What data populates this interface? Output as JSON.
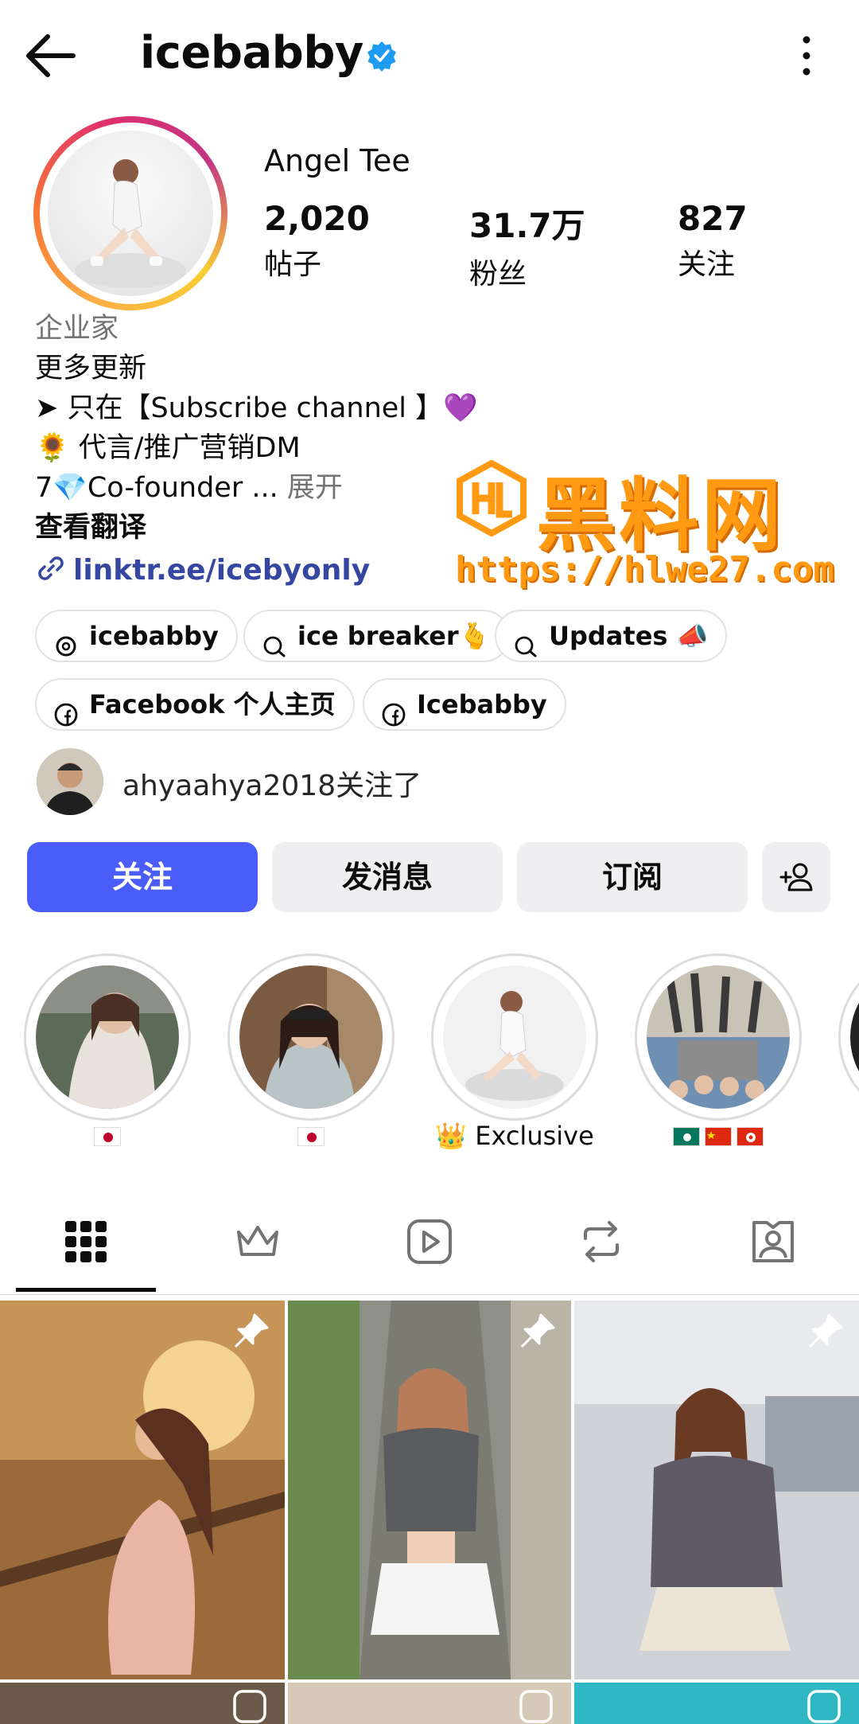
{
  "header": {
    "username": "icebabby",
    "verified": true
  },
  "profile": {
    "display_name": "Angel Tee",
    "stats": [
      {
        "value": "2,020",
        "label": "帖子"
      },
      {
        "value": "31.7万",
        "label": "粉丝"
      },
      {
        "value": "827",
        "label": "关注"
      }
    ],
    "bio": {
      "category": "企业家",
      "lines": [
        "更多更新",
        "➤ 只在【Subscribe channel 】💜",
        "🌻 代言/推广营销DM"
      ],
      "truncated_line": "7💎Co-founder ...",
      "more_label": "展开",
      "translate_label": "查看翻译"
    },
    "link": "linktr.ee/icebyonly"
  },
  "chips": [
    {
      "label": "icebabby",
      "icon": "threads-icon"
    },
    {
      "label": "ice breaker🫰",
      "icon": "channel-icon"
    },
    {
      "label": "Updates 📣",
      "icon": "channel-icon"
    },
    {
      "label": "Facebook 个人主页",
      "icon": "facebook-icon"
    },
    {
      "label": "Icebabby",
      "icon": "facebook-icon"
    }
  ],
  "followed_by": "ahyaahya2018关注了",
  "actions": {
    "follow": "关注",
    "message": "发消息",
    "subscribe": "订阅"
  },
  "highlights": [
    {
      "label": "🇯🇵"
    },
    {
      "label": "🇯🇵"
    },
    {
      "label": "👑 Exclusive"
    },
    {
      "label": "🇲🇴🇨🇳🇭🇰"
    }
  ],
  "tabs": [
    "grid-icon",
    "crown-icon",
    "reels-icon",
    "repost-icon",
    "tagged-icon"
  ],
  "watermark": {
    "title": "黑料网",
    "url": "https://hlwe27.com"
  },
  "colors": {
    "follow_button": "#4a5df9",
    "link": "#3547a0",
    "verified": "#1d9bf0",
    "watermark": "#ff9a12"
  }
}
